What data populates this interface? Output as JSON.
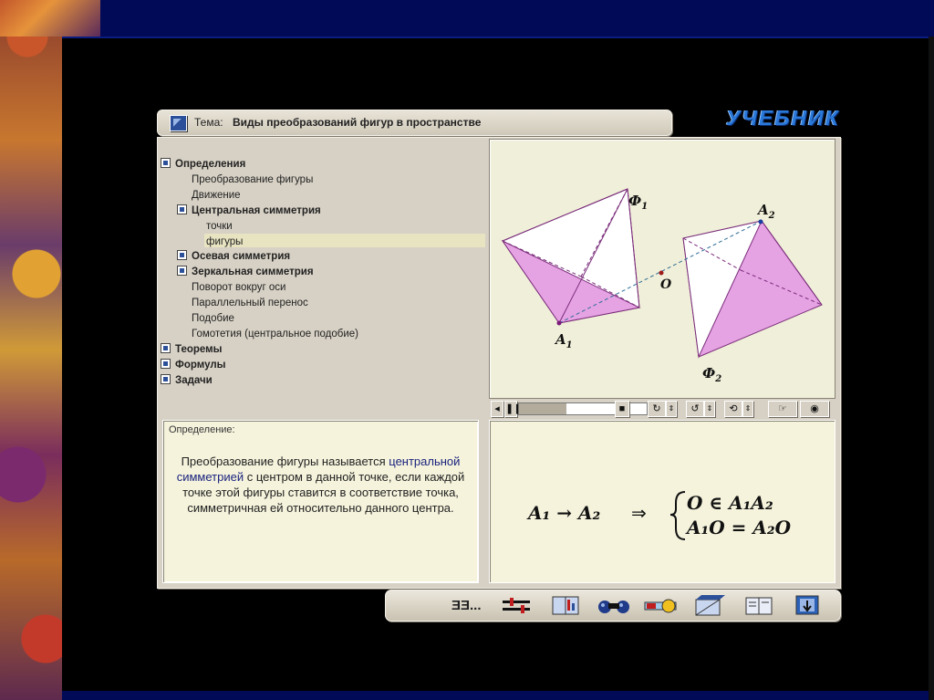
{
  "title_bar": {
    "label": "Тема:",
    "text": "Виды преобразований фигур в пространстве"
  },
  "logo": "УЧЕБНИК",
  "tree": {
    "items": [
      {
        "label": "Определения",
        "level": 0,
        "bold": true,
        "box": true
      },
      {
        "label": "Преобразование фигуры",
        "level": 2,
        "bold": false,
        "box": false
      },
      {
        "label": "Движение",
        "level": 2,
        "bold": false,
        "box": false
      },
      {
        "label": "Центральная симметрия",
        "level": 1,
        "bold": true,
        "box": true
      },
      {
        "label": "точки",
        "level": 3,
        "bold": false,
        "box": false
      },
      {
        "label": "фигуры",
        "level": 3,
        "bold": false,
        "box": false,
        "selected": true
      },
      {
        "label": "Осевая симметрия",
        "level": 1,
        "bold": true,
        "box": true
      },
      {
        "label": "Зеркальная симметрия",
        "level": 1,
        "bold": true,
        "box": true
      },
      {
        "label": "Поворот вокруг оси",
        "level": 2,
        "bold": false,
        "box": false
      },
      {
        "label": "Параллельный перенос",
        "level": 2,
        "bold": false,
        "box": false
      },
      {
        "label": "Подобие",
        "level": 2,
        "bold": false,
        "box": false
      },
      {
        "label": "Гомотетия (центральное подобие)",
        "level": 2,
        "bold": false,
        "box": false
      },
      {
        "label": "Теоремы",
        "level": 0,
        "bold": true,
        "box": true
      },
      {
        "label": "Формулы",
        "level": 0,
        "bold": true,
        "box": true
      },
      {
        "label": "Задачи",
        "level": 0,
        "bold": true,
        "box": true
      }
    ]
  },
  "diagram": {
    "label_phi1": "Ф",
    "label_phi1_sub": "1",
    "label_phi2": "Ф",
    "label_phi2_sub": "2",
    "label_a1": "A",
    "label_a1_sub": "1",
    "label_a2": "A",
    "label_a2_sub": "2",
    "label_o": "O"
  },
  "player": {
    "progress": 0.37
  },
  "definition": {
    "label": "Определение:",
    "text_before": "Преобразование фигуры называется",
    "highlight": "центральной симметрией",
    "text_after": "с центром в данной точке, если каждой точке этой фигуры ставится в соответствие точка, симметричная ей относительно данного центра."
  },
  "formula": {
    "left": "A₁ → A₂",
    "implies": "⇒",
    "line1": "O ∈ A₁A₂",
    "line2": "A₁O = A₂O"
  },
  "toolbar": {
    "icons": [
      "text-direction-icon",
      "sliders-icon",
      "book-chart-icon",
      "binoculars-icon",
      "player-icon",
      "cube-cut-icon",
      "notebook-icon",
      "exit-arrow-icon"
    ],
    "first_label": "ƎƎ..."
  }
}
